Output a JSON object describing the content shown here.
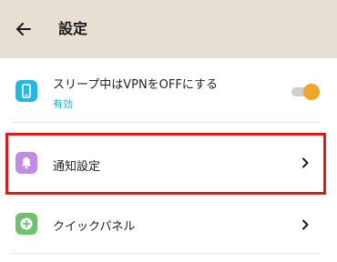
{
  "appbar": {
    "title": "設定",
    "back_icon": "back-arrow-icon"
  },
  "items": [
    {
      "label": "スリープ中はVPNをOFFにする",
      "sublabel": "有効",
      "icon": "phone-icon",
      "icon_color": "#29b7df",
      "toggle_on": true
    },
    {
      "label": "通知設定",
      "icon": "bell-icon",
      "icon_color": "#c28ce6"
    },
    {
      "label": "クイックパネル",
      "icon": "plus-circle-icon",
      "icon_color": "#6fc26c"
    }
  ],
  "colors": {
    "accent": "#f2a52b",
    "highlight": "#e01a1a",
    "appbar": "#e7dfd3"
  }
}
